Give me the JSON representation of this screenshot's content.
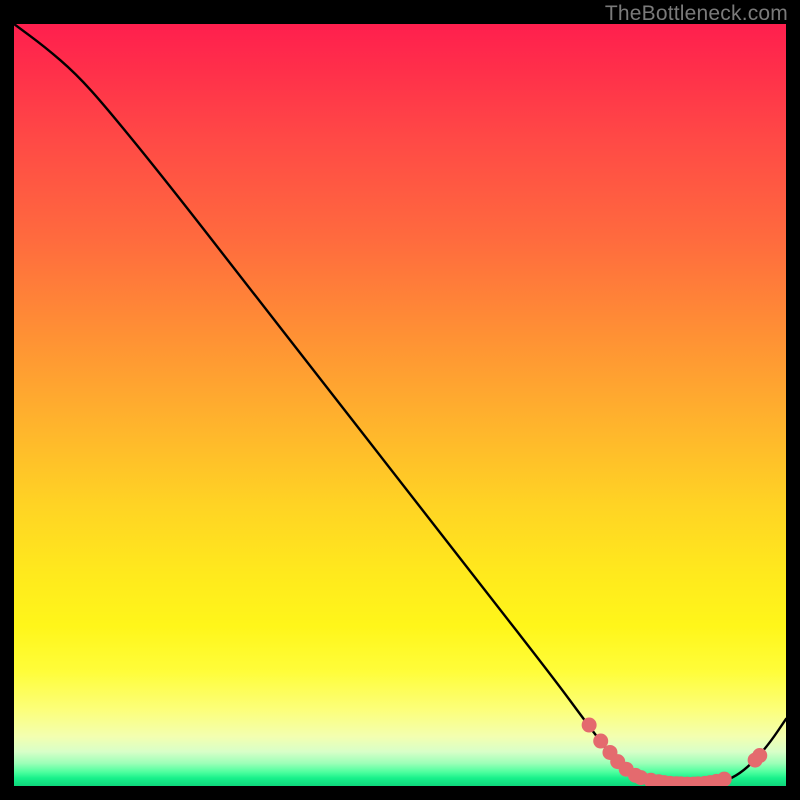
{
  "attribution": "TheBottleneck.com",
  "chart_data": {
    "type": "line",
    "title": "",
    "xlabel": "",
    "ylabel": "",
    "xlim": [
      0,
      100
    ],
    "ylim": [
      0,
      100
    ],
    "series": [
      {
        "name": "bottleneck-curve",
        "x": [
          0,
          4,
          8,
          12,
          20,
          30,
          40,
          50,
          60,
          70,
          74,
          77,
          79,
          80,
          82,
          85,
          88,
          90,
          92,
          94,
          96,
          98,
          100
        ],
        "y": [
          100,
          97,
          93.5,
          89,
          79,
          66,
          53,
          40,
          27,
          14,
          8.5,
          4.5,
          2.4,
          1.6,
          0.9,
          0.3,
          0.15,
          0.2,
          0.6,
          1.6,
          3.4,
          5.8,
          8.8
        ]
      }
    ],
    "markers": [
      {
        "x": 74.5,
        "y": 8.0
      },
      {
        "x": 76.0,
        "y": 5.9
      },
      {
        "x": 77.2,
        "y": 4.4
      },
      {
        "x": 78.2,
        "y": 3.2
      },
      {
        "x": 79.3,
        "y": 2.2
      },
      {
        "x": 80.5,
        "y": 1.4
      },
      {
        "x": 81.2,
        "y": 1.1
      },
      {
        "x": 82.5,
        "y": 0.75
      },
      {
        "x": 83.5,
        "y": 0.55
      },
      {
        "x": 84.2,
        "y": 0.45
      },
      {
        "x": 85.0,
        "y": 0.35
      },
      {
        "x": 85.8,
        "y": 0.3
      },
      {
        "x": 86.4,
        "y": 0.28
      },
      {
        "x": 87.2,
        "y": 0.25
      },
      {
        "x": 88.0,
        "y": 0.25
      },
      {
        "x": 88.6,
        "y": 0.28
      },
      {
        "x": 89.5,
        "y": 0.35
      },
      {
        "x": 90.2,
        "y": 0.45
      },
      {
        "x": 91.0,
        "y": 0.6
      },
      {
        "x": 92.0,
        "y": 0.9
      },
      {
        "x": 96.0,
        "y": 3.4
      },
      {
        "x": 96.6,
        "y": 4.0
      }
    ],
    "gradient_stops": [
      {
        "pos": 0.0,
        "color": "#ff1f4e"
      },
      {
        "pos": 0.3,
        "color": "#ff7a38"
      },
      {
        "pos": 0.6,
        "color": "#ffd324"
      },
      {
        "pos": 0.85,
        "color": "#fffd3a"
      },
      {
        "pos": 0.96,
        "color": "#c8ffc0"
      },
      {
        "pos": 1.0,
        "color": "#0fd67b"
      }
    ],
    "marker_color": "#e46a6e",
    "line_color": "#000000"
  }
}
